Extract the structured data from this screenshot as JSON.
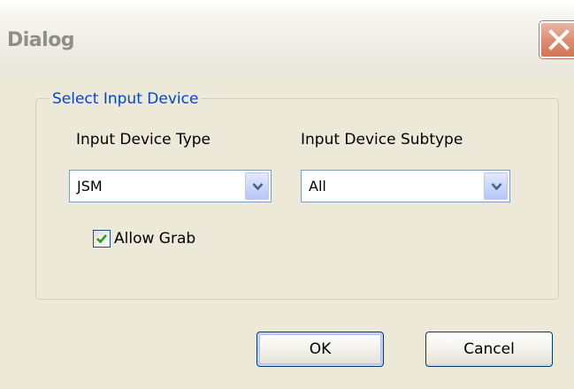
{
  "window": {
    "title": "Dialog",
    "close_icon": "close-icon",
    "close_color": "#d27457"
  },
  "group": {
    "legend": "Select Input Device",
    "legend_color": "#0046d5"
  },
  "device_type": {
    "label": "Input Device Type",
    "value": "JSM",
    "arrow_icon": "chevron-down-icon"
  },
  "device_subtype": {
    "label": "Input Device Subtype",
    "value": "All",
    "arrow_icon": "chevron-down-icon"
  },
  "allow_grab": {
    "label": "Allow Grab",
    "checked": true,
    "check_icon": "checkmark-icon",
    "check_color": "#21a121"
  },
  "buttons": {
    "ok_label": "OK",
    "cancel_label": "Cancel"
  }
}
